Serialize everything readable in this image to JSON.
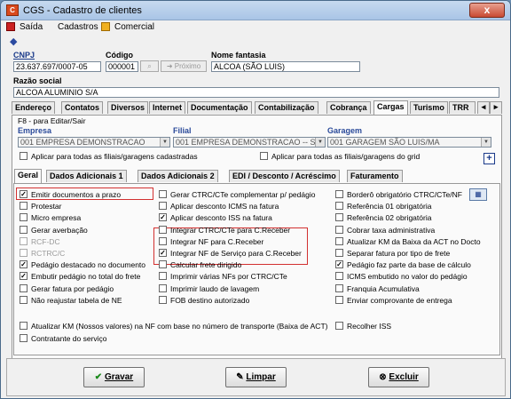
{
  "window": {
    "title": "CGS - Cadastro de clientes",
    "close": "x"
  },
  "menu": {
    "saida": "Saída",
    "cadastros": "Cadastros",
    "comercial": "Comercial"
  },
  "fields": {
    "cnpj_label": "CNPJ",
    "cnpj": "23.637.697/0007-05",
    "codigo_label": "Código",
    "codigo": "000001",
    "proximo": "Próximo",
    "nome_label": "Nome fantasia",
    "nome": "ALCOA (SÃO LUIS)",
    "razao_label": "Razão social",
    "razao": "ALCOA ALUMINIO S/A"
  },
  "tabs": [
    "Endereço",
    "Contatos",
    "Diversos",
    "Internet",
    "Documentação",
    "Contabilização",
    "Cobrança",
    "Cargas",
    "Turismo",
    "TRR"
  ],
  "hint": "F8 - para Editar/Sair",
  "grp": {
    "empresa_label": "Empresa",
    "empresa": "001 EMPRESA DEMONSTRACAO",
    "filial_label": "Filial",
    "filial": "001 EMPRESA DEMONSTRACAO -- S/",
    "garagem_label": "Garagem",
    "garagem": "001 GARAGEM SÃO LUIS/MA",
    "apl1": "Aplicar para todas as filiais/garagens cadastradas",
    "apl2": "Aplicar para todas as filiais/garagens do grid"
  },
  "subtabs": [
    "Geral",
    "Dados Adicionais 1",
    "Dados Adicionais 2",
    "EDI / Desconto / Acréscimo",
    "Faturamento"
  ],
  "col1": [
    {
      "t": "Emitir documentos a prazo",
      "c": true
    },
    {
      "t": "Protestar",
      "c": false
    },
    {
      "t": "Micro empresa",
      "c": false
    },
    {
      "t": "Gerar averbação",
      "c": false
    },
    {
      "t": "RCF-DC",
      "c": false,
      "g": true
    },
    {
      "t": "RCTRC/C",
      "c": false,
      "g": true
    },
    {
      "t": "Pedágio destacado no documento",
      "c": true
    },
    {
      "t": "Embutir pedágio no total do frete",
      "c": true
    },
    {
      "t": "Gerar fatura por pedágio",
      "c": false
    },
    {
      "t": "Não reajustar tabela de NE",
      "c": false
    }
  ],
  "col2": [
    {
      "t": "Gerar CTRC/CTe complementar p/ pedágio",
      "c": false
    },
    {
      "t": "Aplicar desconto ICMS na fatura",
      "c": false
    },
    {
      "t": "Aplicar desconto ISS na fatura",
      "c": true
    },
    {
      "t": "Integrar CTRC/CTe para C.Receber",
      "c": false
    },
    {
      "t": "Integrar NF para C.Receber",
      "c": false
    },
    {
      "t": "Integrar NF de Serviço para C.Receber",
      "c": true
    },
    {
      "t": "Calcular frete dirigido",
      "c": false
    },
    {
      "t": "Imprimir várias NFs por CTRC/CTe",
      "c": false
    },
    {
      "t": "Imprimir laudo de lavagem",
      "c": false
    },
    {
      "t": "FOB destino autorizado",
      "c": false
    }
  ],
  "col3": [
    {
      "t": "Borderô obrigatório CTRC/CTe/NF",
      "c": false
    },
    {
      "t": "Referência 01 obrigatória",
      "c": false
    },
    {
      "t": "Referência 02 obrigatória",
      "c": false
    },
    {
      "t": "Cobrar taxa administrativa",
      "c": false
    },
    {
      "t": "Atualizar KM da Baixa da ACT no Docto",
      "c": false
    },
    {
      "t": "Separar fatura por tipo de frete",
      "c": false
    },
    {
      "t": "Pedágio faz parte da base de cálculo",
      "c": true
    },
    {
      "t": "ICMS embutido no valor do pedágio",
      "c": false
    },
    {
      "t": "Franquia Acumulativa",
      "c": false
    },
    {
      "t": "Enviar comprovante de entrega",
      "c": false
    }
  ],
  "row11a": "Atualizar KM (Nossos valores) na NF com base no número de transporte (Baixa de ACT)",
  "row11b": "Recolher ISS",
  "row12": "Contratante do serviço",
  "buttons": {
    "gravar": "Gravar",
    "limpar": "Limpar",
    "excluir": "Excluir"
  }
}
